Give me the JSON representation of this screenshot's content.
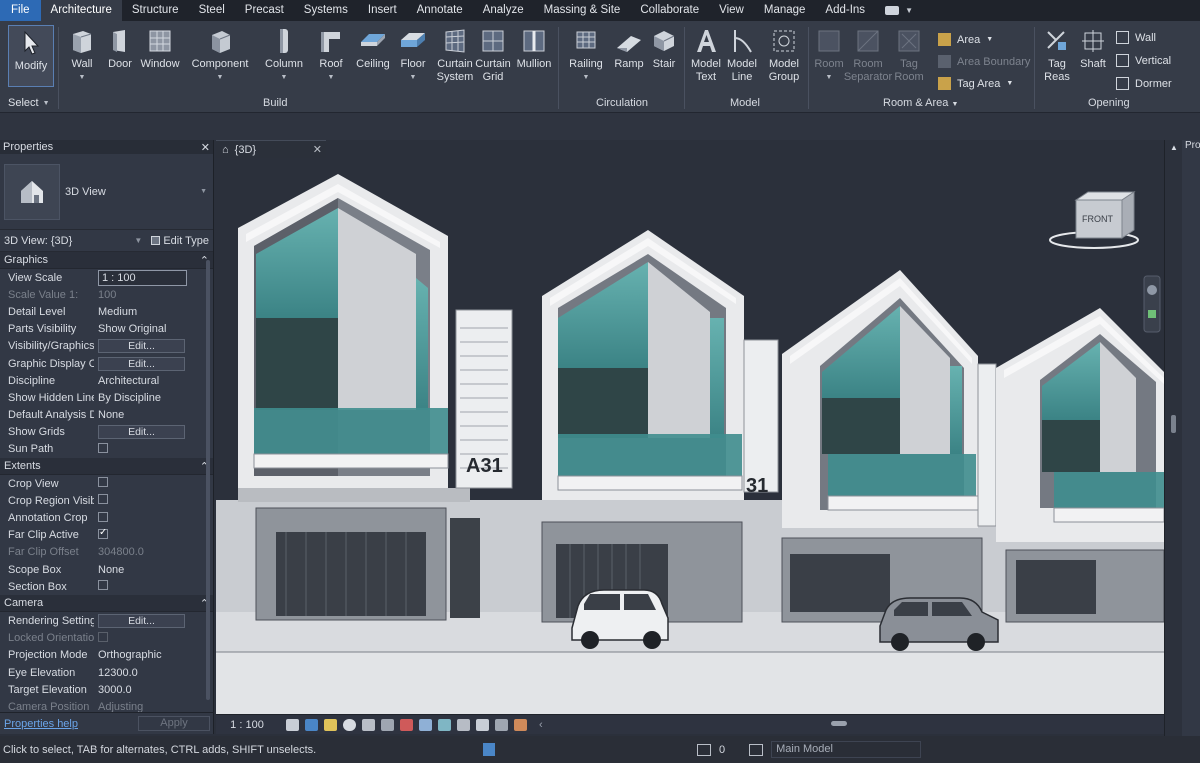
{
  "menu": {
    "file": "File",
    "tabs": [
      "Architecture",
      "Structure",
      "Steel",
      "Precast",
      "Systems",
      "Insert",
      "Annotate",
      "Analyze",
      "Massing & Site",
      "Collaborate",
      "View",
      "Manage",
      "Add-Ins"
    ],
    "active_tab": "Architecture"
  },
  "ribbon": {
    "modify": "Modify",
    "select": "Select",
    "build_tools": [
      {
        "label": "Wall",
        "icon": "wall-icon"
      },
      {
        "label": "Door",
        "icon": "door-icon"
      },
      {
        "label": "Window",
        "icon": "window-icon"
      },
      {
        "label": "Component",
        "icon": "component-icon"
      },
      {
        "label": "Column",
        "icon": "column-icon"
      },
      {
        "label": "Roof",
        "icon": "roof-icon"
      },
      {
        "label": "Ceiling",
        "icon": "ceiling-icon"
      },
      {
        "label": "Floor",
        "icon": "floor-icon"
      }
    ],
    "curtain_system": [
      "Curtain",
      "System"
    ],
    "curtain_grid": [
      "Curtain",
      "Grid"
    ],
    "mullion": "Mullion",
    "build_label": "Build",
    "railing": "Railing",
    "ramp": "Ramp",
    "stair": "Stair",
    "circulation_label": "Circulation",
    "model_text": [
      "Model",
      "Text"
    ],
    "model_line": [
      "Model",
      "Line"
    ],
    "model_group": [
      "Model",
      "Group"
    ],
    "model_label": "Model",
    "room": "Room",
    "room_separator": [
      "Room",
      "Separator"
    ],
    "tag_room": [
      "Tag",
      "Room"
    ],
    "area": "Area",
    "area_boundary": "Area Boundary",
    "tag_area": "Tag Area",
    "room_area_label": "Room & Area",
    "tag_by_face": [
      "Tag",
      "Reas"
    ],
    "shaft": "Shaft",
    "wall_opening": "Wall",
    "vertical": "Vertical",
    "dormer": "Dormer",
    "opening_label": "Opening"
  },
  "properties": {
    "title": "Properties",
    "type_name": "3D View",
    "instance": "3D View: {3D}",
    "edit_type": "Edit Type",
    "categories": {
      "graphics": "Graphics",
      "extents": "Extents",
      "camera": "Camera"
    },
    "graphics_rows": [
      {
        "name": "View Scale",
        "value": "1 : 100",
        "kind": "input"
      },
      {
        "name": "Scale Value    1:",
        "value": "100",
        "kind": "dis"
      },
      {
        "name": "Detail Level",
        "value": "Medium",
        "kind": "text"
      },
      {
        "name": "Parts Visibility",
        "value": "Show Original",
        "kind": "text"
      },
      {
        "name": "Visibility/Graphics O...",
        "value": "Edit...",
        "kind": "button"
      },
      {
        "name": "Graphic Display Opti...",
        "value": "Edit...",
        "kind": "button"
      },
      {
        "name": "Discipline",
        "value": "Architectural",
        "kind": "text"
      },
      {
        "name": "Show Hidden Lines",
        "value": "By Discipline",
        "kind": "text"
      },
      {
        "name": "Default Analysis Disp...",
        "value": "None",
        "kind": "text"
      },
      {
        "name": "Show Grids",
        "value": "Edit...",
        "kind": "button"
      },
      {
        "name": "Sun Path",
        "value": "",
        "kind": "check-off"
      }
    ],
    "extents_rows": [
      {
        "name": "Crop View",
        "value": "",
        "kind": "check-off"
      },
      {
        "name": "Crop Region Visible",
        "value": "",
        "kind": "check-off"
      },
      {
        "name": "Annotation Crop",
        "value": "",
        "kind": "check-off"
      },
      {
        "name": "Far Clip Active",
        "value": "",
        "kind": "check-on"
      },
      {
        "name": "Far Clip Offset",
        "value": "304800.0",
        "kind": "dis"
      },
      {
        "name": "Scope Box",
        "value": "None",
        "kind": "text"
      },
      {
        "name": "Section Box",
        "value": "",
        "kind": "check-off"
      }
    ],
    "camera_rows": [
      {
        "name": "Rendering Settings",
        "value": "Edit...",
        "kind": "button"
      },
      {
        "name": "Locked Orientation",
        "value": "",
        "kind": "check-dis"
      },
      {
        "name": "Projection Mode",
        "value": "Orthographic",
        "kind": "text"
      },
      {
        "name": "Eye Elevation",
        "value": "12300.0",
        "kind": "text"
      },
      {
        "name": "Target Elevation",
        "value": "3000.0",
        "kind": "text"
      },
      {
        "name": "Camera Position",
        "value": "Adjusting",
        "kind": "dis"
      }
    ],
    "help": "Properties help",
    "apply": "Apply"
  },
  "view": {
    "tab_title": "{3D}",
    "viewcube_face": "FRONT",
    "unit_label": "A31",
    "unit_label_2": "31",
    "scale": "1 : 100",
    "right_panel_title": "Pro"
  },
  "status": {
    "message": "Click to select, TAB for alternates, CTRL adds, SHIFT unselects.",
    "count": "0",
    "model": "Main Model"
  },
  "colors": {
    "accent": "#2d6ab5",
    "glass": "#4f9a9a",
    "background": "#2b303b"
  }
}
